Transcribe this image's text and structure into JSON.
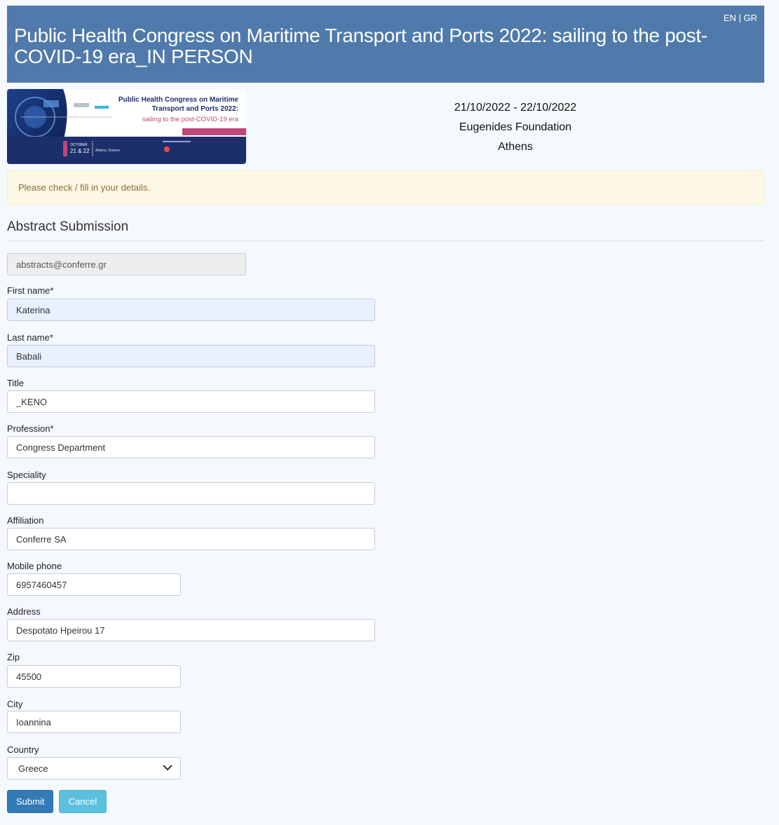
{
  "header": {
    "title": "Public Health Congress on Maritime Transport and Ports 2022: sailing to the post-COVID-19 era_IN PERSON",
    "lang_en": "EN",
    "lang_sep": " | ",
    "lang_gr": "GR"
  },
  "banner": {
    "title_line1": "Public Health Congress on Maritime",
    "title_line2": "Transport and Ports 2022:",
    "subtitle": "sailing to the post-COVID-19 era",
    "month": "OCTOBER",
    "days": "21 & 22",
    "location": "Athens, Greece"
  },
  "event": {
    "dates": "21/10/2022 - 22/10/2022",
    "venue": "Eugenides Foundation",
    "city": "Athens"
  },
  "alert": {
    "text": "Please check / fill in your details."
  },
  "section": {
    "title": "Abstract Submission"
  },
  "form": {
    "email": "abstracts@conferre.gr",
    "first_name": {
      "label": "First name*",
      "value": "Katerina"
    },
    "last_name": {
      "label": "Last name*",
      "value": "Babali"
    },
    "title": {
      "label": "Title",
      "value": "_KENO"
    },
    "profession": {
      "label": "Profession*",
      "value": "Congress Department"
    },
    "speciality": {
      "label": "Speciality",
      "value": ""
    },
    "affiliation": {
      "label": "Affiliation",
      "value": "Conferre SA"
    },
    "mobile": {
      "label": "Mobile phone",
      "value": "6957460457"
    },
    "address": {
      "label": "Address",
      "value": "Despotato Hpeirou 17"
    },
    "zip": {
      "label": "Zip",
      "value": "45500"
    },
    "city": {
      "label": "City",
      "value": "Ioannina"
    },
    "country": {
      "label": "Country",
      "value": "Greece"
    }
  },
  "buttons": {
    "submit": "Submit",
    "cancel": "Cancel"
  },
  "colors": {
    "header_bg": "#4f7aab",
    "alert_bg": "#fcf8e3",
    "submit_bg": "#337ab7",
    "cancel_bg": "#5bc0de"
  }
}
